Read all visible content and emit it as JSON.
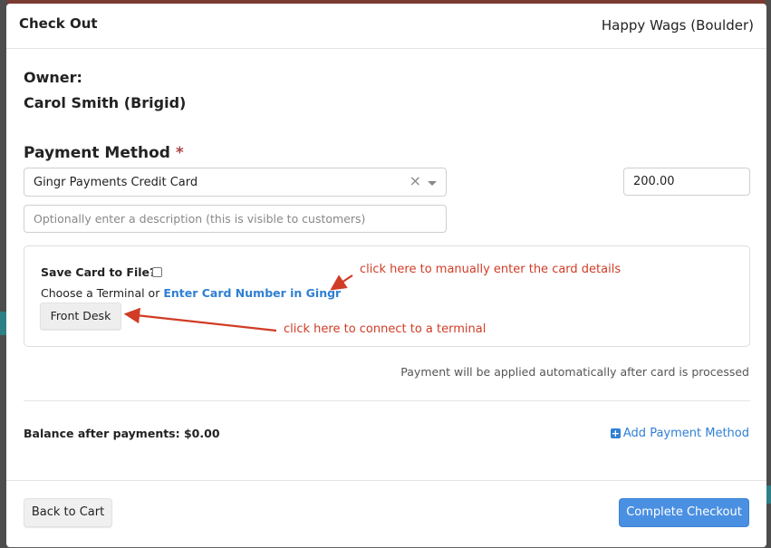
{
  "modal": {
    "title": "Check Out",
    "location": "Happy Wags (Boulder)"
  },
  "owner": {
    "label": "Owner:",
    "name": "Carol Smith (Brigid)"
  },
  "payment": {
    "label": "Payment Method",
    "required_marker": "*",
    "method_selected": "Gingr Payments Credit Card",
    "clear_glyph": "×",
    "amount": "200.00",
    "description_placeholder": "Optionally enter a description (this is visible to customers)"
  },
  "card": {
    "save_label": "Save Card to File?",
    "save_checked": false,
    "terminal_prefix": "Choose a Terminal or ",
    "enter_card_link": "Enter Card Number in Gingr",
    "terminal_button": "Front Desk"
  },
  "annotations": {
    "manual": "click here to manually enter the card details",
    "terminal": "click here to connect to a terminal",
    "color": "#d03c26"
  },
  "note": "Payment will be applied automatically after card is processed",
  "balance": {
    "text": "Balance after payments: $0.00"
  },
  "add_payment_method": "Add Payment Method",
  "footer": {
    "back": "Back to Cart",
    "complete": "Complete Checkout"
  },
  "colors": {
    "primary": "#4a90e2",
    "link": "#2f7fd3",
    "required": "#a94442"
  },
  "icons": {
    "plus": "plus-square-icon",
    "clear": "clear-icon",
    "caret": "caret-down-icon"
  }
}
